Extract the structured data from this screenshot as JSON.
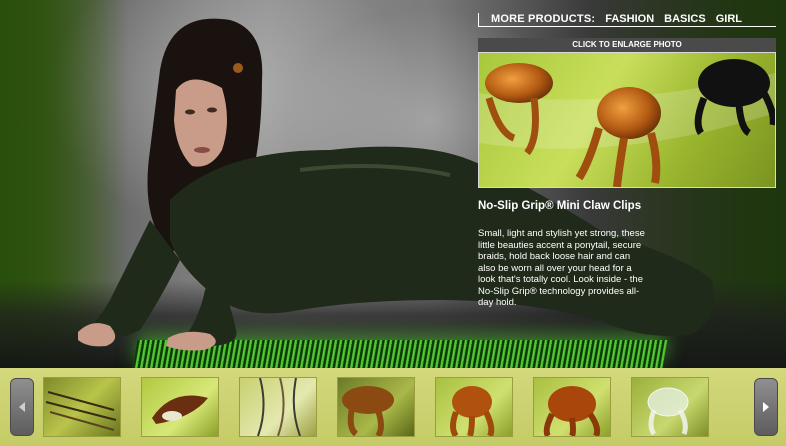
{
  "top_nav": {
    "label": "MORE PRODUCTS:",
    "links": [
      "FASHION",
      "BASICS",
      "GIRL"
    ]
  },
  "photo_panel": {
    "enlarge_label": "CLICK TO ENLARGE PHOTO"
  },
  "product": {
    "title": "No-Slip Grip® Mini Claw Clips",
    "description": "Small, light and stylish yet strong, these little beauties accent a ponytail, secure braids, hold back loose hair and can also be worn all over your head for a look that's totally cool. Look inside - the No-Slip Grip® technology provides all-day hold."
  },
  "thumbnails": [
    {
      "subject": "bobby pins"
    },
    {
      "subject": "snap clips"
    },
    {
      "subject": "hair pins"
    },
    {
      "subject": "claw clip"
    },
    {
      "subject": "mini claw clips"
    },
    {
      "subject": "claw clip"
    },
    {
      "subject": "clear claw clip"
    }
  ],
  "icons": {
    "prev": "chevron-left-icon",
    "next": "chevron-right-icon"
  },
  "colors": {
    "strip_bg": "#c8cf6e",
    "accent_green": "#a8c83a",
    "text": "#ffffff"
  }
}
